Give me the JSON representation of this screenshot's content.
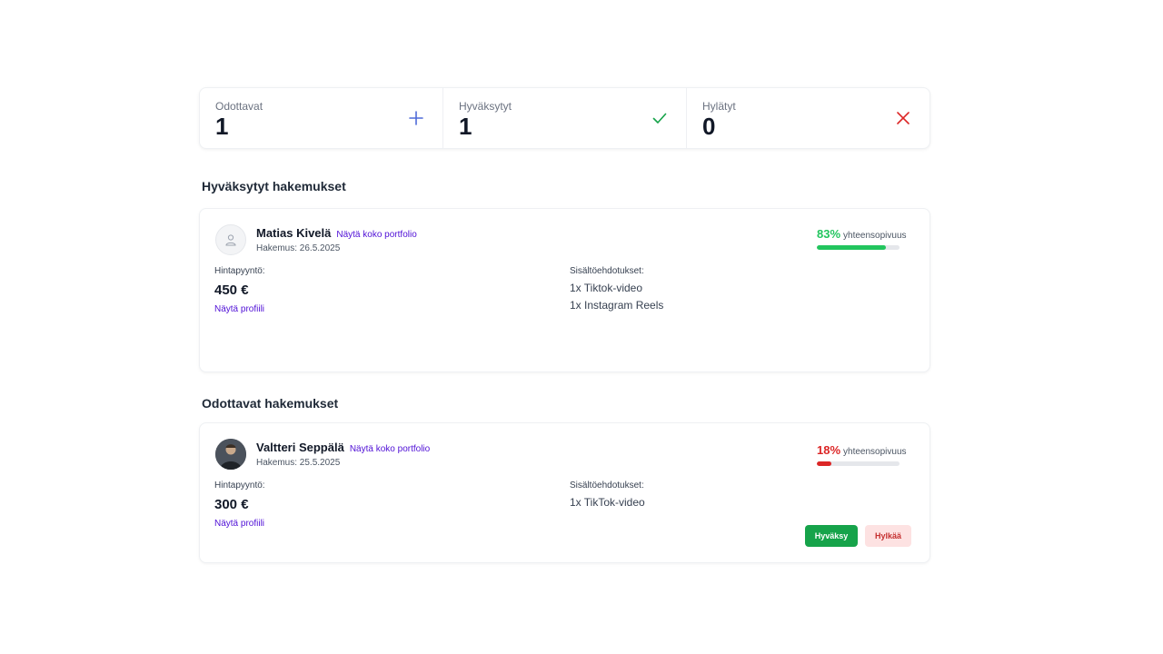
{
  "stats": [
    {
      "label": "Odottavat",
      "value": "1",
      "icon": "plus-icon",
      "color": "#4f6bd8"
    },
    {
      "label": "Hyväksytyt",
      "value": "1",
      "icon": "check-icon",
      "color": "#16a34a"
    },
    {
      "label": "Hylätyt",
      "value": "0",
      "icon": "x-icon",
      "color": "#dc2626"
    }
  ],
  "approved": {
    "heading": "Hyväksytyt hakemukset",
    "card": {
      "name": "Matias Kivelä",
      "portfolio_link": "Näytä koko portfolio",
      "date": "Hakemus: 26.5.2025",
      "price_label": "Hintapyyntö:",
      "price": "450 €",
      "profile_link": "Näytä profiili",
      "content_label": "Sisältöehdotukset:",
      "content_items": [
        "1x Tiktok-video",
        "1x Instagram Reels"
      ],
      "compat_pct": "83%",
      "compat_label": "yhteensopivuus",
      "compat_value": 83,
      "compat_color": "#22c55e"
    }
  },
  "pending": {
    "heading": "Odottavat hakemukset",
    "card": {
      "name": "Valtteri Seppälä",
      "portfolio_link": "Näytä koko portfolio",
      "date": "Hakemus: 25.5.2025",
      "price_label": "Hintapyyntö:",
      "price": "300 €",
      "profile_link": "Näytä profiili",
      "content_label": "Sisältöehdotukset:",
      "content_items": [
        "1x TikTok-video"
      ],
      "compat_pct": "18%",
      "compat_label": "yhteensopivuus",
      "compat_value": 18,
      "compat_color": "#dc2626",
      "approve_label": "Hyväksy",
      "reject_label": "Hylkää"
    }
  }
}
